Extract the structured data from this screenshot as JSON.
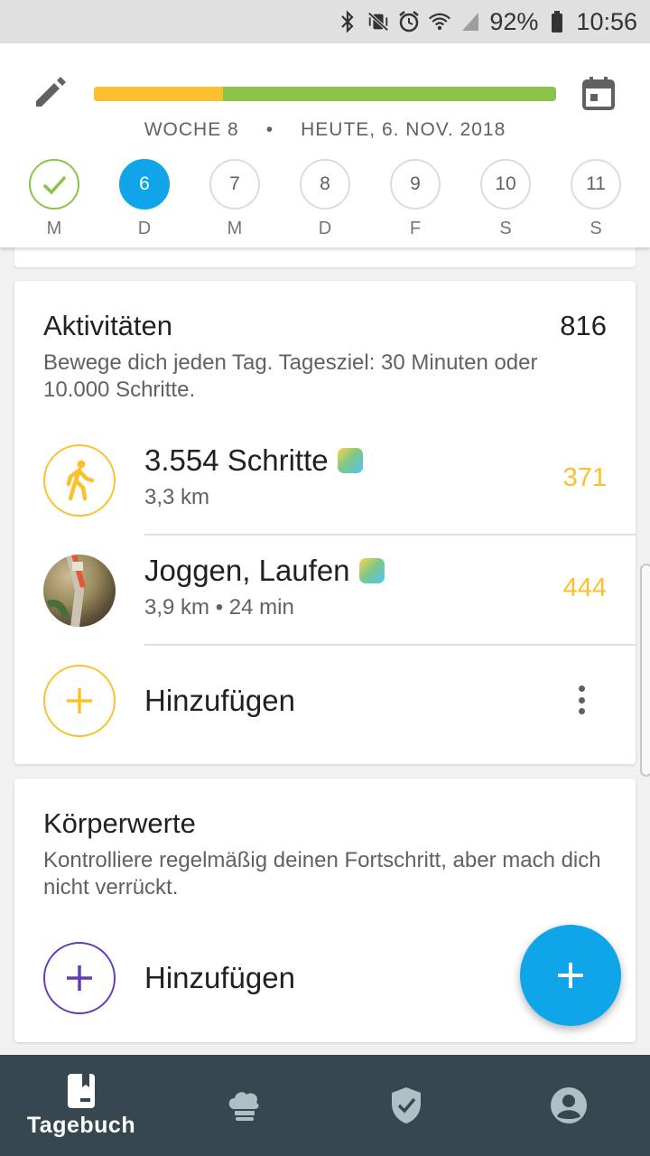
{
  "status_bar": {
    "battery": "92%",
    "time": "10:56",
    "icons": [
      "bluetooth-icon",
      "vibrate-mute-icon",
      "alarm-icon",
      "wifi-icon",
      "signal-icon",
      "battery-icon"
    ]
  },
  "header": {
    "week_label": "WOCHE 8",
    "separator": "•",
    "date_label": "HEUTE, 6. NOV. 2018",
    "progress_fraction_yellow": 0.28,
    "colors": {
      "yellow": "#fbc02d",
      "green": "#8bc34a",
      "accent": "#10a5e8"
    },
    "days": [
      {
        "number": "",
        "letter": "M",
        "state": "done"
      },
      {
        "number": "6",
        "letter": "D",
        "state": "active"
      },
      {
        "number": "7",
        "letter": "M",
        "state": "upcoming"
      },
      {
        "number": "8",
        "letter": "D",
        "state": "upcoming"
      },
      {
        "number": "9",
        "letter": "F",
        "state": "upcoming"
      },
      {
        "number": "10",
        "letter": "S",
        "state": "upcoming"
      },
      {
        "number": "11",
        "letter": "S",
        "state": "upcoming"
      }
    ]
  },
  "activities": {
    "title": "Aktivitäten",
    "total": "816",
    "description": "Bewege dich jeden Tag. Tagesziel: 30 Minuten oder 10.000 Schritte.",
    "items": [
      {
        "title": "3.554 Schritte",
        "subtitle": "3,3 km",
        "value": "371"
      },
      {
        "title": "Joggen, Laufen",
        "subtitle": "3,9 km • 24 min",
        "value": "444"
      }
    ],
    "add_label": "Hinzufügen"
  },
  "body_values": {
    "title": "Körperwerte",
    "description": "Kontrolliere regelmäßig deinen Fortschritt, aber mach dich nicht verrückt.",
    "add_label": "Hinzufügen"
  },
  "bottom_nav": {
    "items": [
      {
        "label": "Tagebuch",
        "icon": "diary-icon",
        "active": true
      },
      {
        "label": "",
        "icon": "chef-hat-icon",
        "active": false
      },
      {
        "label": "",
        "icon": "shield-check-icon",
        "active": false
      },
      {
        "label": "",
        "icon": "profile-icon",
        "active": false
      }
    ]
  }
}
